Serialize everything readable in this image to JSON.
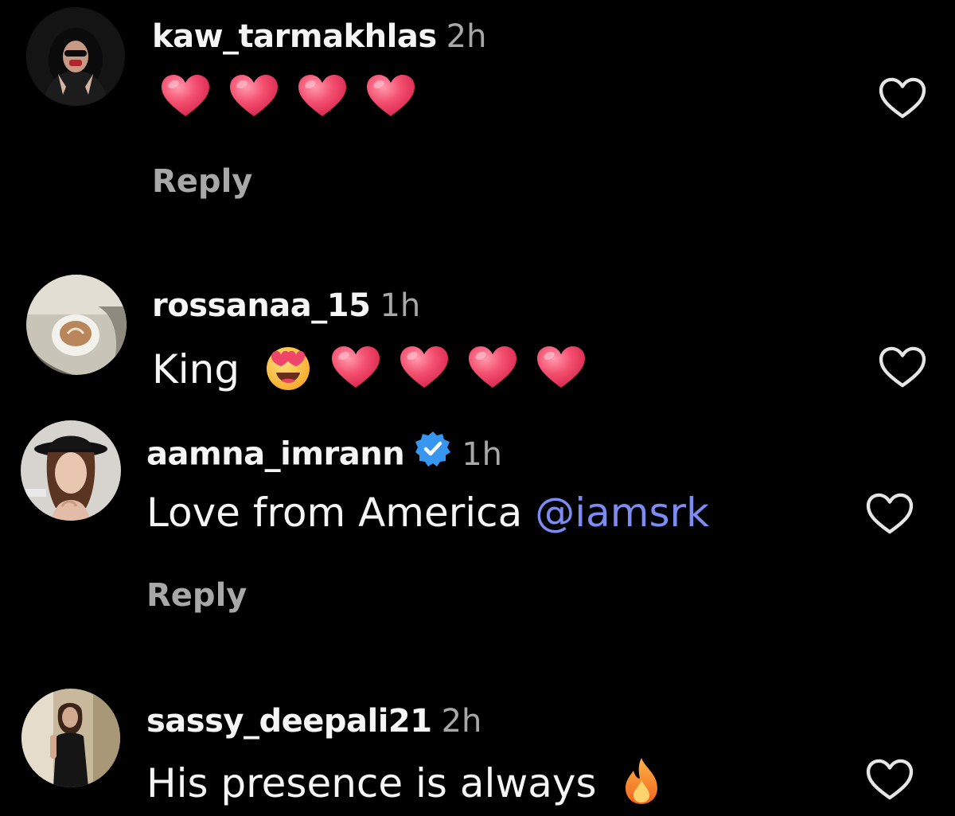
{
  "comments": [
    {
      "username": "kaw_tarmakhlas",
      "time": "2h",
      "text": "",
      "emojis": [
        "heart",
        "heart",
        "heart",
        "heart"
      ],
      "reply_label": "Reply"
    },
    {
      "username": "rossanaa_15",
      "time": "1h",
      "text": "King",
      "emojis": [
        "heart-eyes-face",
        "heart",
        "heart",
        "heart",
        "heart"
      ]
    },
    {
      "username": "aamna_imrann",
      "verified": true,
      "time": "1h",
      "text": "Love from America",
      "mention": "@iamsrk",
      "reply_label": "Reply"
    },
    {
      "username": "sassy_deepali21",
      "time": "2h",
      "text": "His presence is always",
      "emojis": [
        "fire"
      ]
    }
  ],
  "icons": {
    "like": "heart-outline-icon",
    "verified": "verified-badge-icon"
  },
  "colors": {
    "background": "#000000",
    "text": "#f5f5f5",
    "secondary": "#a8a8a8",
    "mention": "#7d8cf5",
    "verified": "#3797f0",
    "heart": "#f0456b"
  }
}
